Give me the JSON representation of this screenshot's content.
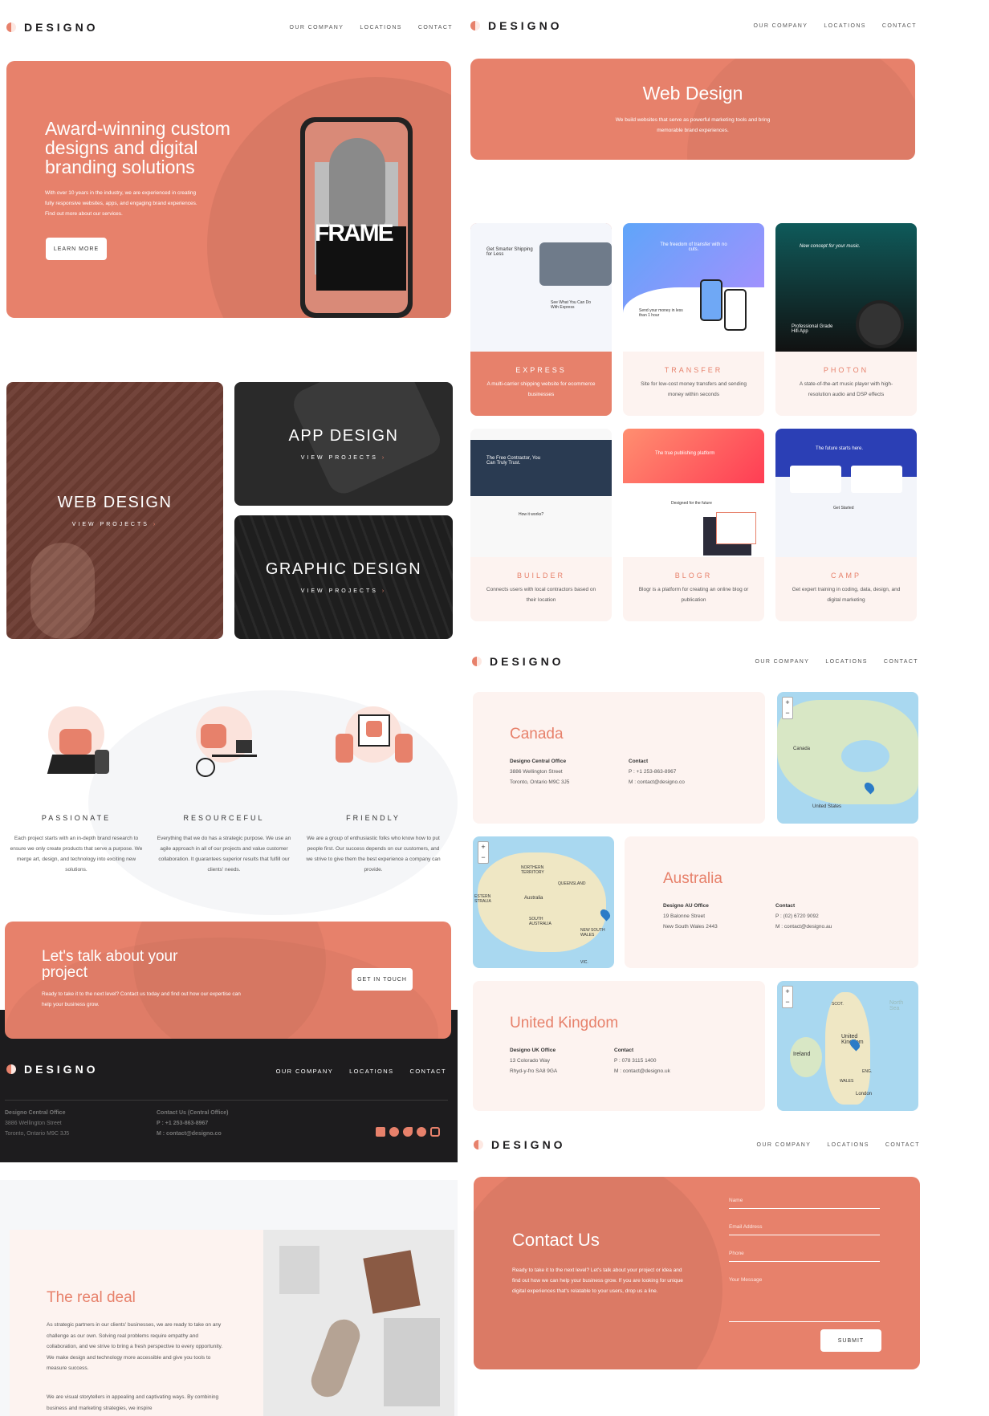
{
  "brand": {
    "logo_text": "DESIGNO",
    "accent": "#e7816b",
    "accent_light": "#fdf3f0",
    "dark": "#1d1c1e"
  },
  "nav": {
    "company": "OUR COMPANY",
    "locations": "LOCATIONS",
    "contact": "CONTACT"
  },
  "hero": {
    "title": "Award-winning custom designs and digital branding solutions",
    "text": "With over 10 years in the industry, we are experienced in creating fully responsive websites, apps, and engaging brand experiences. Find out more about our services.",
    "button": "LEARN MORE",
    "phone_word": "FRAME"
  },
  "design_cards": {
    "web": {
      "title": "WEB DESIGN",
      "link": "VIEW PROJECTS"
    },
    "app": {
      "title": "APP DESIGN",
      "link": "VIEW PROJECTS"
    },
    "graphic": {
      "title": "GRAPHIC DESIGN",
      "link": "VIEW PROJECTS"
    }
  },
  "values": [
    {
      "title": "PASSIONATE",
      "text": "Each project starts with an in-depth brand research to ensure we only create products that serve a purpose. We merge art, design, and technology into exciting new solutions."
    },
    {
      "title": "RESOURCEFUL",
      "text": "Everything that we do has a strategic purpose. We use an agile approach in all of our projects and value customer collaboration. It guarantees superior results that fulfill our clients' needs."
    },
    {
      "title": "FRIENDLY",
      "text": "We are a group of enthusiastic folks who know how to put people first. Our success depends on our customers, and we strive to give them the best experience a company can provide."
    }
  ],
  "cta": {
    "title": "Let's talk about your project",
    "text": "Ready to take it to the next level? Contact us today and find out how our expertise can help your business grow.",
    "button": "GET IN TOUCH"
  },
  "footer": {
    "office_title": "Designo Central Office",
    "office_line1": "3886 Wellington Street",
    "office_line2": "Toronto, Ontario M9C 3J5",
    "contact_title": "Contact Us (Central Office)",
    "phone": "P : +1 253-863-8967",
    "email": "M : contact@designo.co",
    "social": [
      "facebook-icon",
      "youtube-icon",
      "twitter-icon",
      "pinterest-icon",
      "instagram-icon"
    ]
  },
  "deal": {
    "title": "The real deal",
    "p1": "As strategic partners in our clients' businesses, we are ready to take on any challenge as our own. Solving real problems require empathy and collaboration, and we strive to bring a fresh perspective to every opportunity. We make design and technology more accessible and give you tools to measure success.",
    "p2": "We are visual storytellers in appealing and captivating ways. By combining business and marketing strategies, we inspire"
  },
  "webdesign": {
    "title": "Web Design",
    "text": "We build websites that serve as powerful marketing tools and bring memorable brand experiences."
  },
  "projects": [
    {
      "name": "EXPRESS",
      "desc": "A multi-carrier shipping website for ecommerce businesses",
      "shot_title": "Get Smarter Shipping for Less",
      "shot_sub": "See What You Can Do With Express"
    },
    {
      "name": "TRANSFER",
      "desc": "Site for low-cost money transfers and sending money within seconds",
      "shot_title": "The freedom of transfer with no cuts.",
      "shot_sub": "Send your money in less than 1 hour"
    },
    {
      "name": "PHOTON",
      "desc": "A state-of-the-art music player with high-resolution audio and DSP effects",
      "shot_title": "New concept for your music.",
      "shot_sub": "Professional Grade Hifi App"
    },
    {
      "name": "BUILDER",
      "desc": "Connects users with local contractors based on their location",
      "shot_title": "The Free Contractor, You Can Truly Trust.",
      "shot_sub": "How it works?"
    },
    {
      "name": "BLOGR",
      "desc": "Blogr is a platform for creating an online blog or publication",
      "shot_title": "The true publishing platform",
      "shot_sub": "Designed for the future"
    },
    {
      "name": "CAMP",
      "desc": "Get expert training in coding, data, design, and digital marketing",
      "shot_title": "The future starts here.",
      "shot_sub": "Get Started"
    }
  ],
  "locations": [
    {
      "country": "Canada",
      "office": "Designo Central Office",
      "addr1": "3886 Wellington Street",
      "addr2": "Toronto, Ontario M9C 3J5",
      "contact": "Contact",
      "phone": "P : +1 253-863-8967",
      "email": "M : contact@designo.co",
      "map_labels": [
        "Canada",
        "United States"
      ]
    },
    {
      "country": "Australia",
      "office": "Designo AU Office",
      "addr1": "19 Balonne Street",
      "addr2": "New South Wales 2443",
      "contact": "Contact",
      "phone": "P : (02) 6720 9092",
      "email": "M : contact@designo.au",
      "map_labels": [
        "NORTHERN TERRITORY",
        "QUEENSLAND",
        "Australia",
        "SOUTH AUSTRALIA",
        "NEW SOUTH WALES",
        "ESTERN STRALIA",
        "VIC."
      ]
    },
    {
      "country": "United Kingdom",
      "office": "Designo UK Office",
      "addr1": "13 Colorado Way",
      "addr2": "Rhyd-y-fro SA8 9GA",
      "contact": "Contact",
      "phone": "P : 078 3115 1400",
      "email": "M : contact@designo.uk",
      "map_labels": [
        "Ireland",
        "United Kingdom",
        "North Sea",
        "ENG.",
        "SCOT.",
        "WALES",
        "London"
      ]
    }
  ],
  "zoom": {
    "plus": "+",
    "minus": "−"
  },
  "contact_form": {
    "title": "Contact Us",
    "text": "Ready to take it to the next level? Let's talk about your project or idea and find out how we can help your business grow. If you are looking for unique digital experiences that's relatable to your users, drop us a line.",
    "name_ph": "Name",
    "email_ph": "Email Address",
    "phone_ph": "Phone",
    "message_ph": "Your Message",
    "submit": "SUBMIT"
  }
}
